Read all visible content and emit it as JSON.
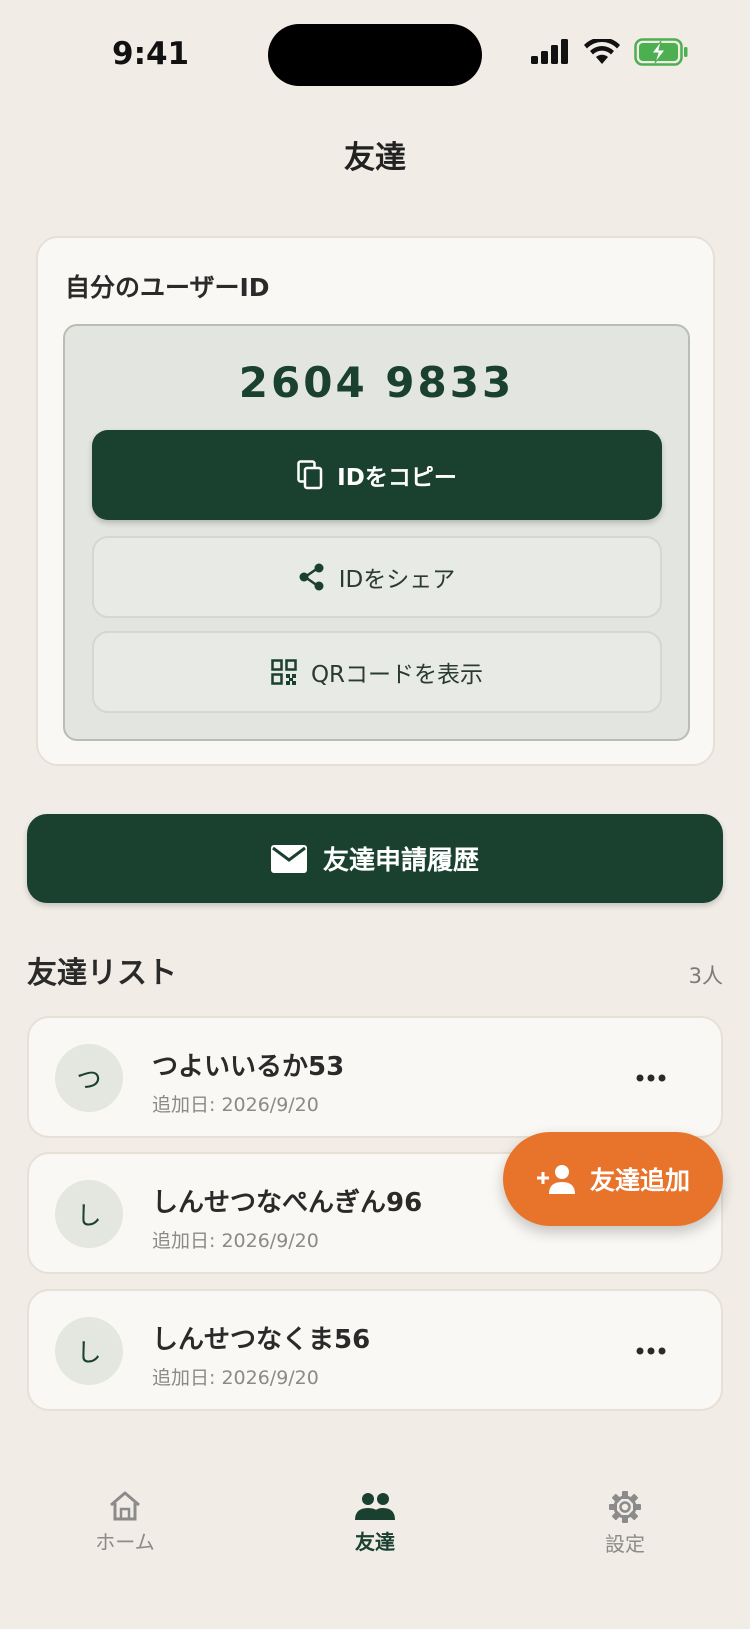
{
  "status_bar": {
    "time": "9:41"
  },
  "header": {
    "title": "友達"
  },
  "id_card": {
    "label": "自分のユーザーID",
    "user_id": "2604 9833",
    "copy_label": "IDをコピー",
    "share_label": "IDをシェア",
    "qr_label": "QRコードを表示"
  },
  "requests_button": {
    "label": "友達申請履歴"
  },
  "friend_list": {
    "title": "友達リスト",
    "count": "3人",
    "items": [
      {
        "initial": "つ",
        "name": "つよいいるか53",
        "date": "追加日: 2026/9/20"
      },
      {
        "initial": "し",
        "name": "しんせつなぺんぎん96",
        "date": "追加日: 2026/9/20"
      },
      {
        "initial": "し",
        "name": "しんせつなくま56",
        "date": "追加日: 2026/9/20"
      }
    ]
  },
  "fab": {
    "label": "友達追加"
  },
  "tab_bar": {
    "home": "ホーム",
    "friends": "友達",
    "settings": "設定"
  },
  "colors": {
    "background": "#f1ece6",
    "primary": "#1a4030",
    "accent": "#e8742c",
    "battery": "#4caf50"
  }
}
